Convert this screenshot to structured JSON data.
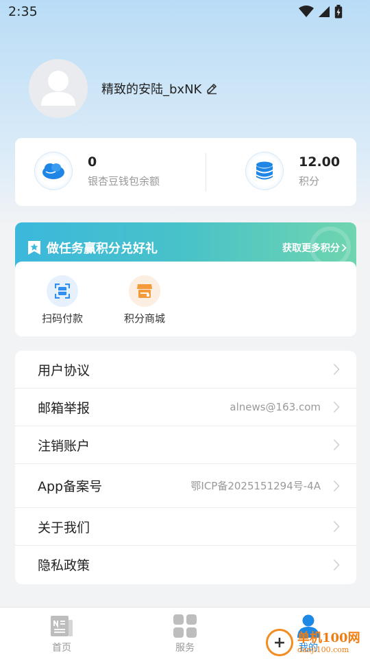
{
  "status": {
    "time": "2:35"
  },
  "profile": {
    "username": "精致的安陆_bxNK"
  },
  "wallet": {
    "balance_value": "0",
    "balance_label": "银杏豆钱包余额",
    "points_value": "12.00",
    "points_label": "积分"
  },
  "tasks": {
    "title": "做任务赢积分兑好礼",
    "more": "获取更多积分"
  },
  "services": [
    {
      "label": "扫码付款",
      "icon": "scan-icon",
      "color": "#2f8ef0"
    },
    {
      "label": "积分商城",
      "icon": "store-icon",
      "color": "#f59a3a"
    }
  ],
  "menu": [
    {
      "label": "用户协议",
      "value": ""
    },
    {
      "label": "邮箱举报",
      "value": "alnews@163.com"
    },
    {
      "label": "注销账户",
      "value": ""
    },
    {
      "label": "App备案号",
      "value": "鄂ICP备2025151294号-4A"
    },
    {
      "label": "关于我们",
      "value": ""
    },
    {
      "label": "隐私政策",
      "value": ""
    }
  ],
  "tabs": [
    {
      "label": "首页",
      "icon": "news-icon",
      "active": false
    },
    {
      "label": "服务",
      "icon": "grid-icon",
      "active": false
    },
    {
      "label": "我的",
      "icon": "person-icon",
      "active": true
    }
  ],
  "watermark": {
    "name": "单机100网",
    "url": "danji100.com"
  },
  "colors": {
    "accent": "#1e88e5",
    "banner_start": "#3bb8dc",
    "banner_end": "#6fd5ae"
  }
}
